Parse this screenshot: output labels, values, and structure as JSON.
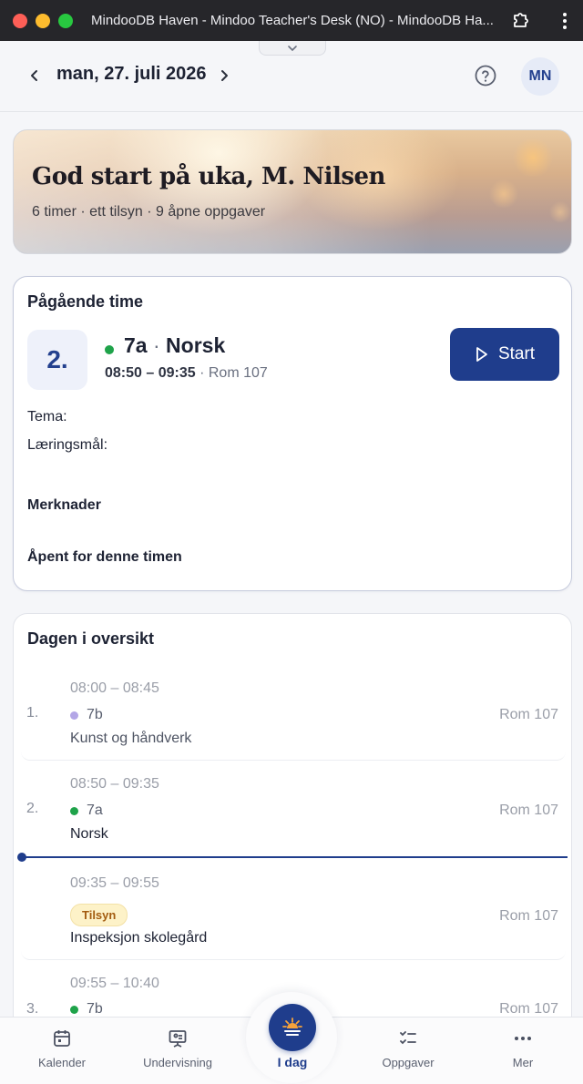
{
  "window": {
    "title": "MindooDB Haven - Mindoo Teacher's Desk (NO) - MindooDB Ha..."
  },
  "header": {
    "date": "man, 27. juli 2026",
    "avatar_initials": "MN"
  },
  "hero": {
    "title": "God start på uka, M. Nilsen",
    "subtitle": "6 timer · ett tilsyn · 9 åpne oppgaver"
  },
  "current_lesson": {
    "section_title": "Pågående time",
    "period": "2.",
    "class_name": "7a",
    "separator": "·",
    "subject": "Norsk",
    "time": "08:50 – 09:35",
    "room": "· Rom 107",
    "start_label": "Start",
    "topic_label": "Tema:",
    "goals_label": "Læringsmål:",
    "notes_label": "Merknader",
    "open_label": "Åpent for denne timen",
    "status_color": "#1fa34a"
  },
  "overview": {
    "title": "Dagen i oversikt",
    "rows": [
      {
        "num": "1.",
        "time": "08:00 – 08:45",
        "cls": "7b",
        "subject": "Kunst og håndverk",
        "room": "Rom 107",
        "dot_color": "#b3a6e6"
      },
      {
        "num": "2.",
        "time": "08:50 – 09:35",
        "cls": "7a",
        "subject": "Norsk",
        "room": "Rom 107",
        "dot_color": "#1fa34a"
      },
      {
        "num": "",
        "time": "09:35 – 09:55",
        "badge": "Tilsyn",
        "subject": "Inspeksjon skolegård",
        "room": "Rom 107"
      },
      {
        "num": "3.",
        "time": "09:55 – 10:40",
        "cls": "7b",
        "subject": "",
        "room": "Rom 107",
        "dot_color": "#1fa34a"
      }
    ]
  },
  "tabs": [
    {
      "label": "Kalender",
      "icon": "calendar-icon"
    },
    {
      "label": "Undervisning",
      "icon": "presentation-icon"
    },
    {
      "label": "I dag",
      "icon": "sunrise-icon"
    },
    {
      "label": "Oppgaver",
      "icon": "checklist-icon"
    },
    {
      "label": "Mer",
      "icon": "more-icon"
    }
  ],
  "colors": {
    "accent": "#1f3d8c",
    "background": "#f5f6f9"
  }
}
